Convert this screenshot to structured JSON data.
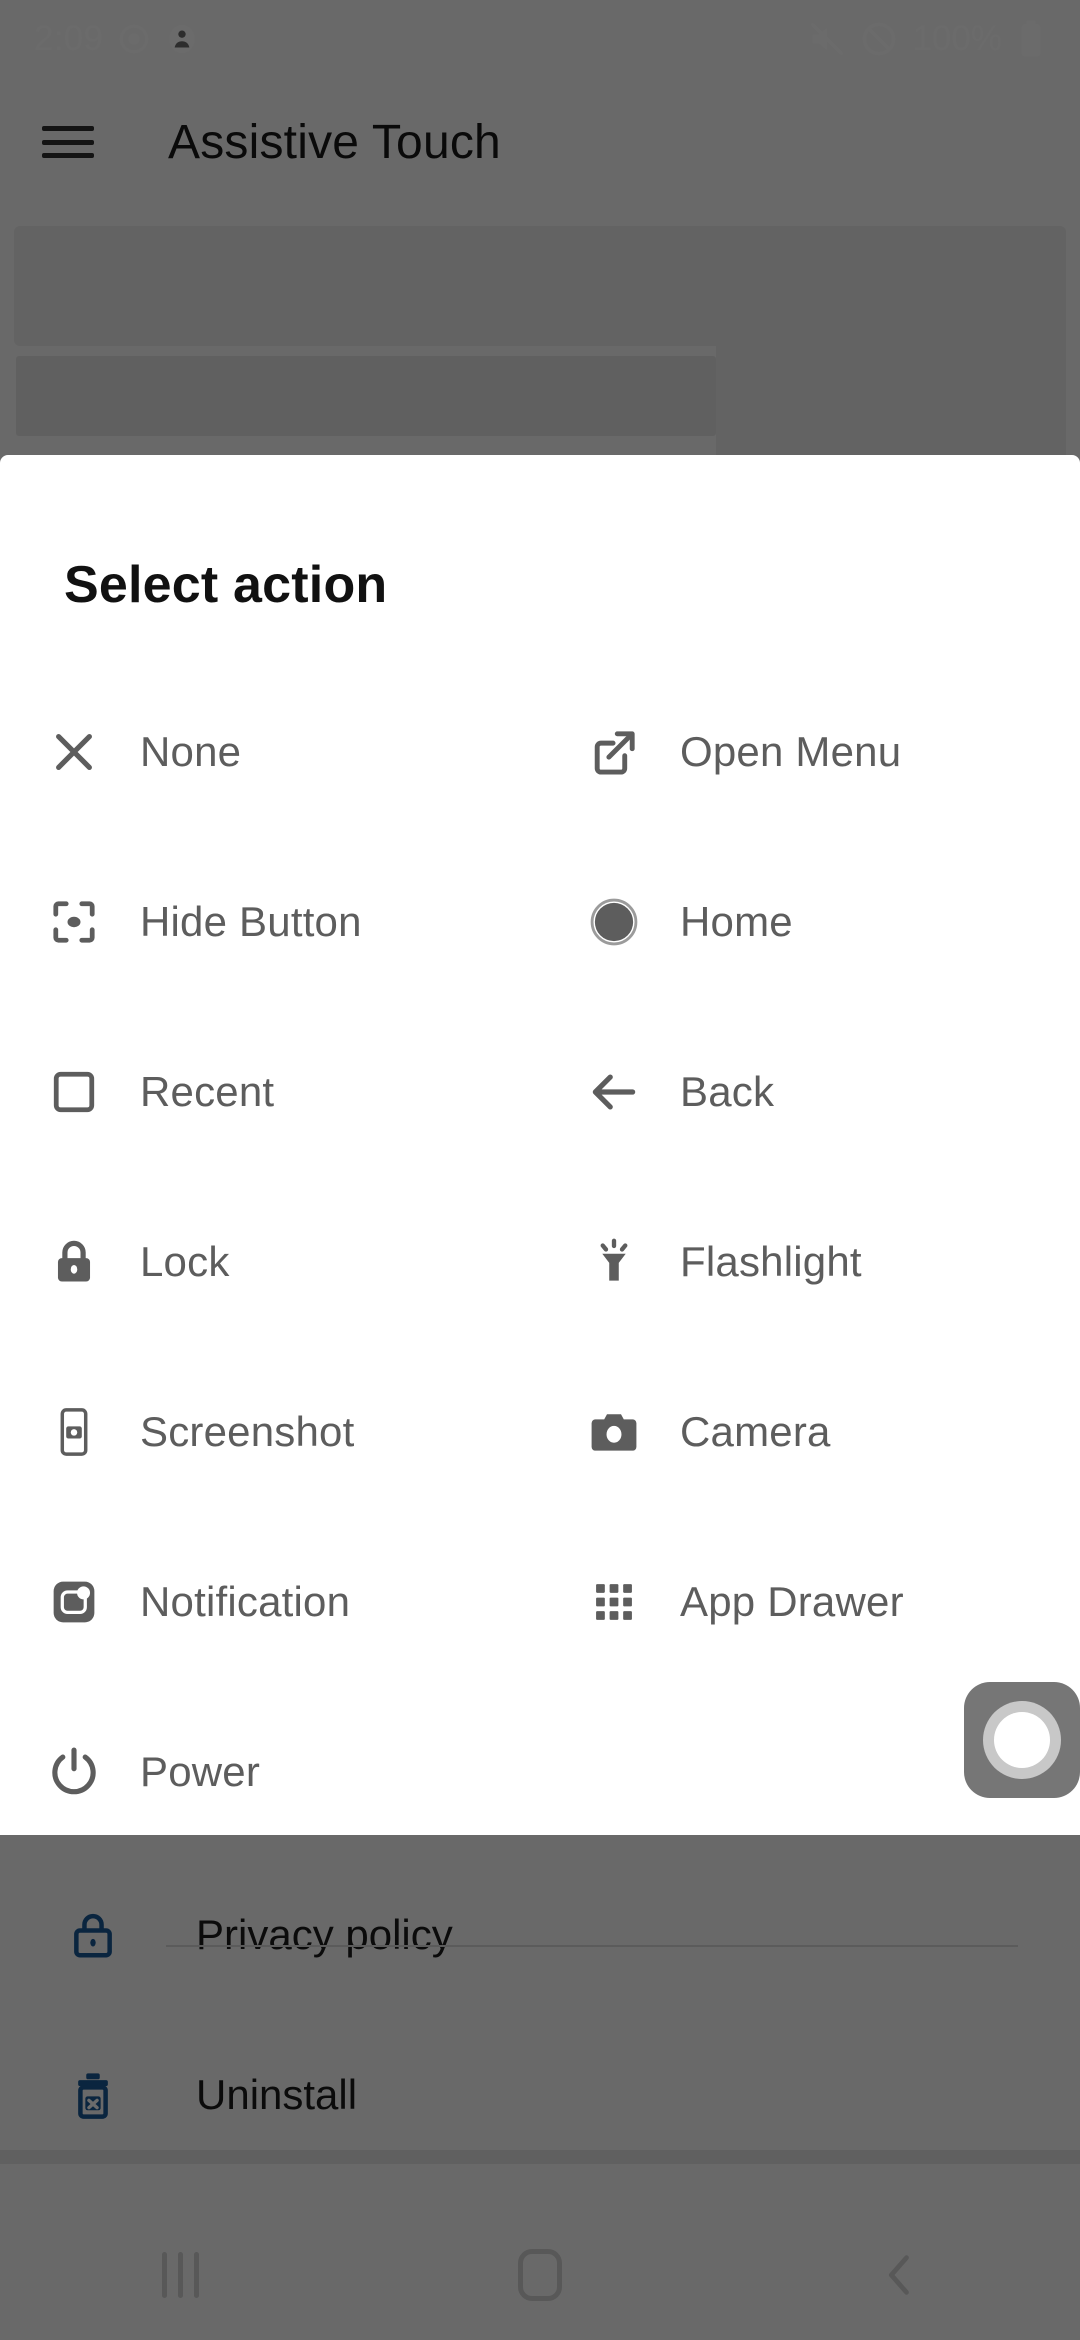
{
  "status_bar": {
    "time": "2:09",
    "battery_percent": "100%",
    "icons": [
      "record-icon",
      "account-icon",
      "volume-off-icon",
      "do-not-disturb-icon",
      "battery-full-icon"
    ]
  },
  "app_bar": {
    "menu_icon": "hamburger-menu-icon",
    "title": "Assistive Touch"
  },
  "background_list": [
    {
      "label": "Privacy policy",
      "icon": "lock-icon",
      "color": "#1a5a96"
    },
    {
      "label": "Uninstall",
      "icon": "delete-icon",
      "color": "#1a5a96"
    }
  ],
  "sheet": {
    "title": "Select action",
    "actions": [
      {
        "label": "None",
        "icon": "close-icon"
      },
      {
        "label": "Open Menu",
        "icon": "open-in-new-icon"
      },
      {
        "label": "Hide Button",
        "icon": "hide-button-icon"
      },
      {
        "label": "Home",
        "icon": "home-circle-icon"
      },
      {
        "label": "Recent",
        "icon": "recent-square-icon"
      },
      {
        "label": "Back",
        "icon": "arrow-back-icon"
      },
      {
        "label": "Lock",
        "icon": "lock-icon"
      },
      {
        "label": "Flashlight",
        "icon": "flashlight-icon"
      },
      {
        "label": "Screenshot",
        "icon": "screenshot-icon"
      },
      {
        "label": "Camera",
        "icon": "camera-icon"
      },
      {
        "label": "Notification",
        "icon": "notification-icon"
      },
      {
        "label": "App Drawer",
        "icon": "app-drawer-icon"
      },
      {
        "label": "Power",
        "icon": "power-icon"
      }
    ]
  },
  "floating_button": {
    "icon": "assistive-touch-bubble-icon"
  },
  "nav_bar": {
    "recent": "recent-nav-icon",
    "home": "home-nav-icon",
    "back": "back-nav-icon"
  },
  "colors": {
    "icon_gray": "#5d5d5d",
    "label_gray": "#5d5d5d",
    "accent_blue": "#1a5a96",
    "scrim": "rgba(0,0,0,0.58)"
  }
}
